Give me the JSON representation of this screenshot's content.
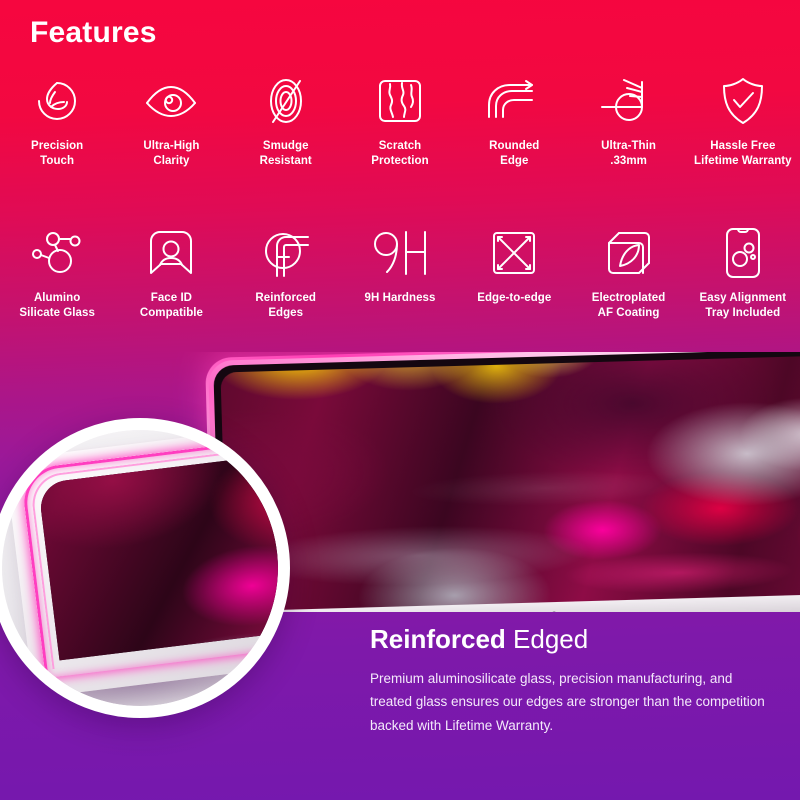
{
  "theme": {
    "gradient_top": "#f6063f",
    "gradient_mid": "#9a199a",
    "gradient_bottom": "#7418ae",
    "icon_stroke": "#ffffff",
    "text_color": "#ffffff",
    "body_text_color": "#f4e9fb",
    "edge_glow": "#ff3ec0"
  },
  "header": {
    "title": "Features"
  },
  "features_row1": [
    {
      "icon": "precision-touch-icon",
      "label": "Precision\nTouch"
    },
    {
      "icon": "eye-clarity-icon",
      "label": "Ultra-High\nClarity"
    },
    {
      "icon": "smudge-resistant-icon",
      "label": "Smudge\nResistant"
    },
    {
      "icon": "scratch-protection-icon",
      "label": "Scratch\nProtection"
    },
    {
      "icon": "rounded-edge-icon",
      "label": "Rounded\nEdge"
    },
    {
      "icon": "ultra-thin-icon",
      "label": "Ultra-Thin\n.33mm"
    },
    {
      "icon": "shield-check-icon",
      "label": "Hassle Free\nLifetime Warranty"
    }
  ],
  "features_row2": [
    {
      "icon": "molecule-icon",
      "label": "Alumino\nSilicate Glass"
    },
    {
      "icon": "face-id-icon",
      "label": "Face ID\nCompatible"
    },
    {
      "icon": "reinforced-edges-icon",
      "label": "Reinforced\nEdges"
    },
    {
      "icon": "hardness-9h-icon",
      "label": "9H Hardness"
    },
    {
      "icon": "edge-to-edge-icon",
      "label": "Edge-to-edge"
    },
    {
      "icon": "af-coating-icon",
      "label": "Electroplated\nAF Coating"
    },
    {
      "icon": "alignment-tray-icon",
      "label": "Easy Alignment\nTray Included"
    }
  ],
  "product_shot": {
    "device": "tablet-device",
    "wallpaper": "abstract-marble-wallpaper",
    "magnifier": "edge-magnifier-circle"
  },
  "callout": {
    "heading_strong": "Reinforced",
    "heading_light": "Edged",
    "body": "Premium aluminosilicate glass, precision manufacturing, and treated glass ensures our edges are stronger than the competition backed with Lifetime Warranty."
  }
}
